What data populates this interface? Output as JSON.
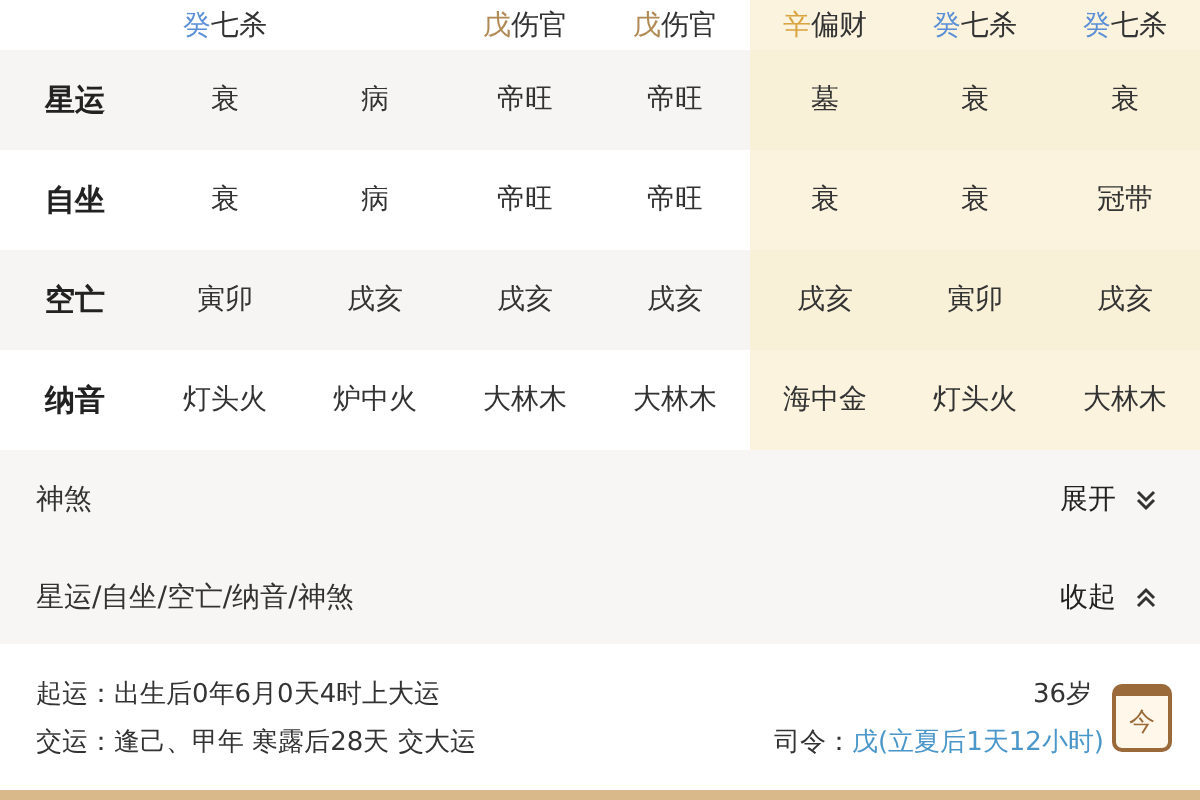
{
  "columns": [
    {
      "stem": "癸",
      "color": "#5b8fd6",
      "god": "七杀",
      "highlighted": false
    },
    {
      "highlighted": false
    },
    {
      "stem": "戊",
      "color": "#b08a55",
      "god": "伤官",
      "highlighted": false
    },
    {
      "stem": "戊",
      "color": "#b08a55",
      "god": "伤官",
      "highlighted": false
    },
    {
      "stem": "辛",
      "color": "#d9a441",
      "god": "偏财",
      "highlighted": true
    },
    {
      "stem": "癸",
      "color": "#5b8fd6",
      "god": "七杀",
      "highlighted": true
    },
    {
      "stem": "癸",
      "color": "#5b8fd6",
      "god": "七杀",
      "highlighted": true
    }
  ],
  "rows": [
    {
      "label": "星运",
      "cells": [
        "衰",
        "病",
        "帝旺",
        "帝旺",
        "墓",
        "衰",
        "衰"
      ]
    },
    {
      "label": "自坐",
      "cells": [
        "衰",
        "病",
        "帝旺",
        "帝旺",
        "衰",
        "衰",
        "冠带"
      ]
    },
    {
      "label": "空亡",
      "cells": [
        "寅卯",
        "戌亥",
        "戌亥",
        "戌亥",
        "戌亥",
        "寅卯",
        "戌亥"
      ]
    },
    {
      "label": "纳音",
      "cells": [
        "灯头火",
        "炉中火",
        "大林木",
        "大林木",
        "海中金",
        "灯头火",
        "大林木"
      ]
    }
  ],
  "sections": [
    {
      "title": "神煞",
      "toggle": "展开",
      "expanded": false
    },
    {
      "title": "星运/自坐/空亡/纳音/神煞",
      "toggle": "收起",
      "expanded": true
    }
  ],
  "luck": {
    "start_label": "起运：",
    "start_text": "出生后0年6月0天4时上大运",
    "age": "36岁",
    "change_label": "交运：",
    "change_text": "逢己、甲年 寒露后28天 交大运",
    "command_label": "司令：",
    "command_value": "戊(立夏后1天12小时)",
    "calendar_label": "今"
  }
}
